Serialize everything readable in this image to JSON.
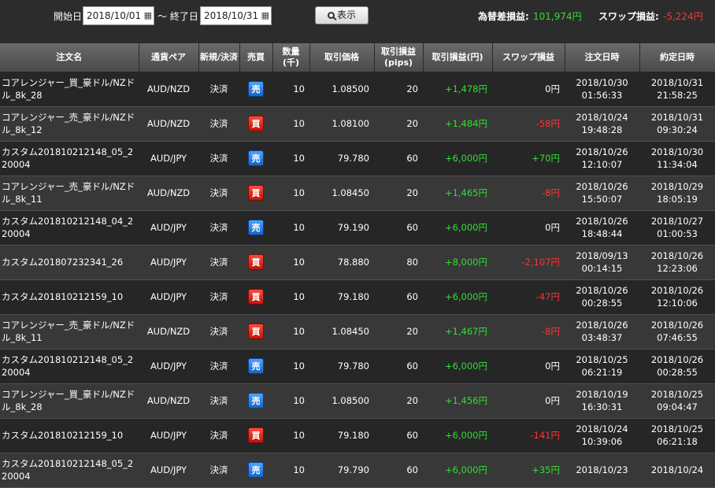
{
  "filter": {
    "start_label": "開始日",
    "start_value": "2018/10/01",
    "separator": "～ 終了日",
    "end_value": "2018/10/31",
    "show_button": "表示"
  },
  "summary": {
    "fx_label": "為替差損益:",
    "fx_value": "101,974円",
    "swap_label": "スワップ損益:",
    "swap_value": "-5,224円"
  },
  "colors": {
    "positive": "#33dd33",
    "negative": "#ff3333",
    "sell_badge": "#2a7fe0",
    "buy_badge": "#e0281a"
  },
  "table": {
    "headers": [
      "注文名",
      "通貨ペア",
      "新規/決済",
      "売買",
      "数量\n(千)",
      "取引価格",
      "取引損益\n(pips)",
      "取引損益(円)",
      "スワップ損益",
      "注文日時",
      "約定日時"
    ],
    "rows": [
      {
        "name": "コアレンジャー_買_豪ドル/NZドル_8k_28",
        "pair": "AUD/NZD",
        "type": "決済",
        "side": "売",
        "qty": "10",
        "price": "1.08500",
        "pips": "20",
        "pl": "+1,478円",
        "swap": "0円",
        "ord_date": "2018/10/30",
        "ord_time": "01:56:33",
        "exe_date": "2018/10/31",
        "exe_time": "21:58:25"
      },
      {
        "name": "コアレンジャー_売_豪ドル/NZドル_8k_12",
        "pair": "AUD/NZD",
        "type": "決済",
        "side": "買",
        "qty": "10",
        "price": "1.08100",
        "pips": "20",
        "pl": "+1,484円",
        "swap": "-58円",
        "ord_date": "2018/10/24",
        "ord_time": "19:48:28",
        "exe_date": "2018/10/31",
        "exe_time": "09:30:24"
      },
      {
        "name": "カスタム201810212148_05_220004",
        "pair": "AUD/JPY",
        "type": "決済",
        "side": "売",
        "qty": "10",
        "price": "79.780",
        "pips": "60",
        "pl": "+6,000円",
        "swap": "+70円",
        "ord_date": "2018/10/26",
        "ord_time": "12:10:07",
        "exe_date": "2018/10/30",
        "exe_time": "11:34:04"
      },
      {
        "name": "コアレンジャー_売_豪ドル/NZドル_8k_11",
        "pair": "AUD/NZD",
        "type": "決済",
        "side": "買",
        "qty": "10",
        "price": "1.08450",
        "pips": "20",
        "pl": "+1,465円",
        "swap": "-8円",
        "ord_date": "2018/10/26",
        "ord_time": "15:50:07",
        "exe_date": "2018/10/29",
        "exe_time": "18:05:19"
      },
      {
        "name": "カスタム201810212148_04_220004",
        "pair": "AUD/JPY",
        "type": "決済",
        "side": "売",
        "qty": "10",
        "price": "79.190",
        "pips": "60",
        "pl": "+6,000円",
        "swap": "0円",
        "ord_date": "2018/10/26",
        "ord_time": "18:48:44",
        "exe_date": "2018/10/27",
        "exe_time": "01:00:53"
      },
      {
        "name": "カスタム201807232341_26",
        "pair": "AUD/JPY",
        "type": "決済",
        "side": "買",
        "qty": "10",
        "price": "78.880",
        "pips": "80",
        "pl": "+8,000円",
        "swap": "-2,107円",
        "ord_date": "2018/09/13",
        "ord_time": "00:14:15",
        "exe_date": "2018/10/26",
        "exe_time": "12:23:06"
      },
      {
        "name": "カスタム201810212159_10",
        "pair": "AUD/JPY",
        "type": "決済",
        "side": "買",
        "qty": "10",
        "price": "79.180",
        "pips": "60",
        "pl": "+6,000円",
        "swap": "-47円",
        "ord_date": "2018/10/26",
        "ord_time": "00:28:55",
        "exe_date": "2018/10/26",
        "exe_time": "12:10:06"
      },
      {
        "name": "コアレンジャー_売_豪ドル/NZドル_8k_11",
        "pair": "AUD/NZD",
        "type": "決済",
        "side": "買",
        "qty": "10",
        "price": "1.08450",
        "pips": "20",
        "pl": "+1,467円",
        "swap": "-8円",
        "ord_date": "2018/10/26",
        "ord_time": "03:48:37",
        "exe_date": "2018/10/26",
        "exe_time": "07:46:55"
      },
      {
        "name": "カスタム201810212148_05_220004",
        "pair": "AUD/JPY",
        "type": "決済",
        "side": "売",
        "qty": "10",
        "price": "79.780",
        "pips": "60",
        "pl": "+6,000円",
        "swap": "0円",
        "ord_date": "2018/10/25",
        "ord_time": "06:21:19",
        "exe_date": "2018/10/26",
        "exe_time": "00:28:55"
      },
      {
        "name": "コアレンジャー_買_豪ドル/NZドル_8k_28",
        "pair": "AUD/NZD",
        "type": "決済",
        "side": "売",
        "qty": "10",
        "price": "1.08500",
        "pips": "20",
        "pl": "+1,456円",
        "swap": "0円",
        "ord_date": "2018/10/19",
        "ord_time": "16:30:31",
        "exe_date": "2018/10/25",
        "exe_time": "09:04:47"
      },
      {
        "name": "カスタム201810212159_10",
        "pair": "AUD/JPY",
        "type": "決済",
        "side": "買",
        "qty": "10",
        "price": "79.180",
        "pips": "60",
        "pl": "+6,000円",
        "swap": "-141円",
        "ord_date": "2018/10/24",
        "ord_time": "10:39:06",
        "exe_date": "2018/10/25",
        "exe_time": "06:21:18"
      },
      {
        "name": "カスタム201810212148_05_220004",
        "pair": "AUD/JPY",
        "type": "決済",
        "side": "売",
        "qty": "10",
        "price": "79.790",
        "pips": "60",
        "pl": "+6,000円",
        "swap": "+35円",
        "ord_date": "2018/10/23",
        "ord_time": "",
        "exe_date": "2018/10/24",
        "exe_time": ""
      }
    ]
  }
}
